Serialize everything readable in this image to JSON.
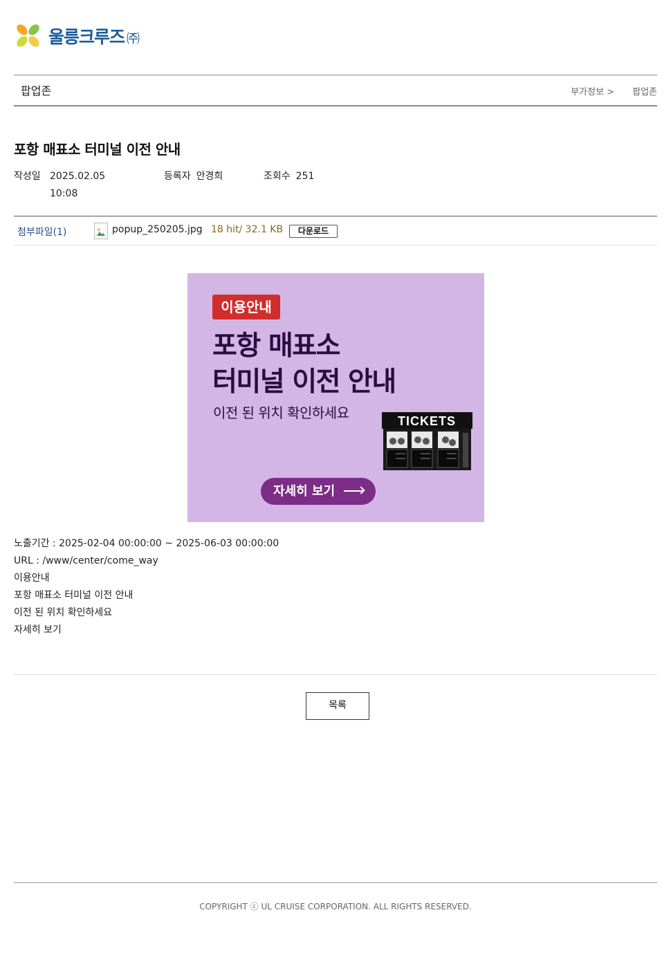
{
  "logo": {
    "name": "울릉크루즈",
    "corp": "㈜"
  },
  "header": {
    "section_title": "팝업존",
    "breadcrumb": [
      "부가정보 >",
      "팝업존"
    ]
  },
  "post": {
    "title": "포항 매표소 터미널 이전 안내",
    "date_label": "작성일",
    "date_value": "2025.02.05 10:08",
    "author_label": "등록자",
    "author_value": "안경희",
    "views_label": "조회수",
    "views_value": "251"
  },
  "attachment": {
    "label": "첨부파일(1)",
    "file_name": "popup_250205.jpg",
    "file_info": "18 hit/ 32.1 KB",
    "download_label": "다운로드"
  },
  "banner": {
    "badge": "이용안내",
    "headline_1": "포항 매표소",
    "headline_2": "터미널 이전 안내",
    "subtitle": "이전 된 위치 확인하세요",
    "tickets_sign": "TICKETS",
    "cta": "자세히 보기",
    "colors": {
      "background": "#d3b6e6",
      "badge": "#d12d2d",
      "cta": "#7c2d87",
      "headline": "#2d0b3f"
    }
  },
  "body_lines": [
    "노출기간 : 2025-02-04 00:00:00 ~ 2025-06-03 00:00:00",
    "URL : /www/center/come_way",
    "이용안내",
    "포항 매표소 터미널 이전 안내",
    "이전 된 위치 확인하세요",
    "자세히 보기"
  ],
  "list_button": "목록",
  "footer": {
    "copyright": "COPYRIGHT ⓒ UL CRUISE CORPORATION. ALL RIGHTS RESERVED."
  }
}
